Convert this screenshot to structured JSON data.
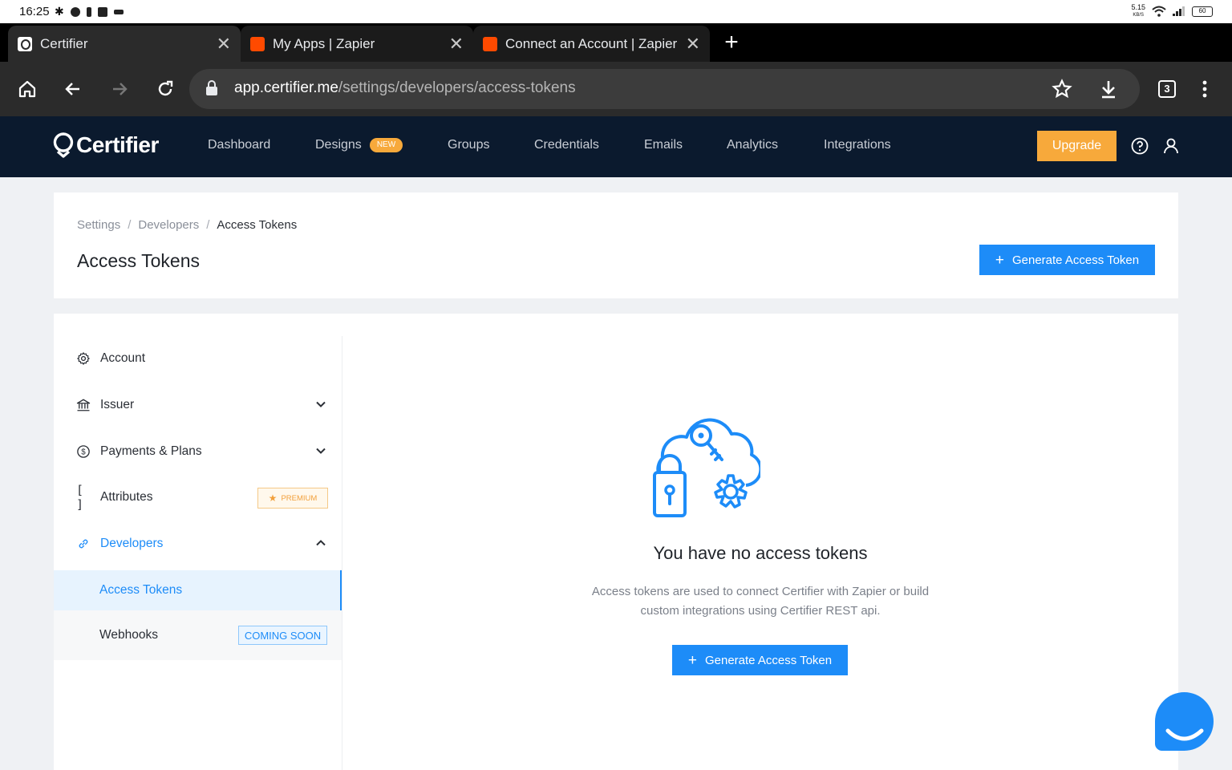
{
  "statusbar": {
    "time": "16:25",
    "net_speed": "5.15",
    "net_unit": "KB/S",
    "battery": "60"
  },
  "browser": {
    "tabs": [
      {
        "title": "Certifier",
        "favicon": "certifier-favicon",
        "active": true
      },
      {
        "title": "My Apps | Zapier",
        "favicon": "zapier-favicon",
        "active": false
      },
      {
        "title": "Connect an Account | Zapier",
        "favicon": "zapier-favicon",
        "active": false
      }
    ],
    "url_host": "app.certifier.me",
    "url_path": "/settings/developers/access-tokens",
    "tab_count": "3"
  },
  "appnav": {
    "brand": "Certifier",
    "items": [
      {
        "label": "Dashboard"
      },
      {
        "label": "Designs",
        "badge": "NEW"
      },
      {
        "label": "Groups"
      },
      {
        "label": "Credentials"
      },
      {
        "label": "Emails"
      },
      {
        "label": "Analytics"
      },
      {
        "label": "Integrations"
      }
    ],
    "upgrade_label": "Upgrade"
  },
  "header": {
    "breadcrumb": [
      "Settings",
      "Developers",
      "Access Tokens"
    ],
    "title": "Access Tokens",
    "generate_label": "Generate Access Token"
  },
  "sidebar": {
    "items": [
      {
        "label": "Account",
        "icon": "gear-icon"
      },
      {
        "label": "Issuer",
        "icon": "bank-icon"
      },
      {
        "label": "Payments & Plans",
        "icon": "dollar-icon"
      },
      {
        "label": "Attributes",
        "icon": "brackets-icon",
        "badge": "PREMIUM"
      },
      {
        "label": "Developers",
        "icon": "link-icon"
      }
    ],
    "subitems": [
      {
        "label": "Access Tokens"
      },
      {
        "label": "Webhooks",
        "badge": "COMING SOON"
      }
    ]
  },
  "empty_state": {
    "title": "You have no access tokens",
    "description_line1": "Access tokens are used to connect Certifier with Zapier or build",
    "description_line2": "custom integrations using Certifier REST api.",
    "button_label": "Generate Access Token"
  },
  "colors": {
    "accent": "#1d8cf8",
    "brand_orange": "#f7a93b",
    "nav_bg": "#0b1a2e"
  }
}
